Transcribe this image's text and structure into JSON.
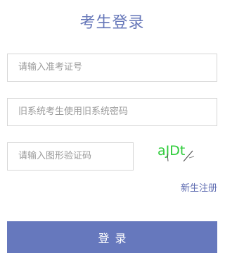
{
  "form": {
    "title": "考生登录",
    "exam_id_placeholder": "请输入准考证号",
    "password_placeholder": "旧系统考生使用旧系统密码",
    "captcha_placeholder": "请输入图形验证码",
    "captcha_text": "aJDt",
    "register_label": "新生注册",
    "login_label": "登录"
  },
  "colors": {
    "accent": "#6678bd",
    "title": "#6677b9",
    "captcha_text": "#2ecc3a"
  }
}
